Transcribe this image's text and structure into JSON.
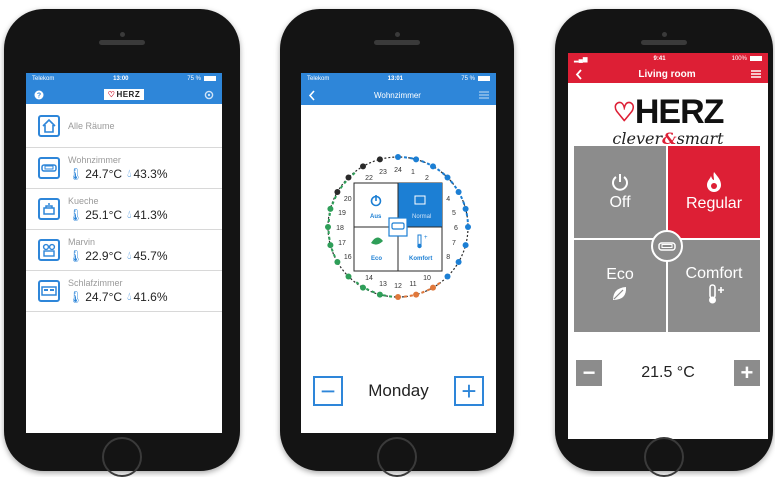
{
  "phone_list": {
    "status": {
      "carrier": "Telekom",
      "time": "13:00",
      "battery": "75 %"
    },
    "header": {
      "help_icon": "help-icon",
      "logo": "HERZ",
      "settings_icon": "gear-icon"
    },
    "rooms": [
      {
        "name": "Alle Räume",
        "temp": "",
        "humidity": "",
        "icon": "house-icon"
      },
      {
        "name": "Wohnzimmer",
        "temp": "24.7°C",
        "humidity": "43.3%",
        "icon": "sofa-icon"
      },
      {
        "name": "Kueche",
        "temp": "25.1°C",
        "humidity": "41.3%",
        "icon": "pot-icon"
      },
      {
        "name": "Marvin",
        "temp": "22.9°C",
        "humidity": "45.7%",
        "icon": "toys-icon"
      },
      {
        "name": "Schlafzimmer",
        "temp": "24.7°C",
        "humidity": "41.6%",
        "icon": "bed-icon"
      }
    ]
  },
  "phone_schedule": {
    "status": {
      "carrier": "Telekom",
      "time": "13:01",
      "battery": "75 %"
    },
    "header": {
      "title": "Wohnzimmer"
    },
    "modes": [
      "Aus",
      "Normal",
      "Eco",
      "Komfort"
    ],
    "clock_hours": [
      "24",
      "1",
      "2",
      "3",
      "4",
      "5",
      "6",
      "7",
      "8",
      "9",
      "10",
      "11",
      "12",
      "13",
      "14",
      "15",
      "16",
      "17",
      "18",
      "19",
      "20",
      "21",
      "22",
      "23"
    ],
    "day": "Monday",
    "minus": "−",
    "plus": "+"
  },
  "phone_room": {
    "status": {
      "time": "9:41",
      "battery": "100%"
    },
    "header": {
      "title": "Living room"
    },
    "logo": {
      "brand": "HERZ",
      "tagline_1": "clever",
      "tagline_amp": "&",
      "tagline_2": "smart"
    },
    "modes": [
      {
        "label": "Off",
        "icon": "power-icon",
        "active": false
      },
      {
        "label": "Regular",
        "icon": "flame-icon",
        "active": true
      },
      {
        "label": "Eco",
        "icon": "leaf-icon",
        "active": false
      },
      {
        "label": "Comfort",
        "icon": "thermometer-plus-icon",
        "active": false
      }
    ],
    "temperature": "21.5 °C",
    "minus": "−",
    "plus": "+",
    "colors": {
      "accent": "#dd1f35",
      "tile": "#8c8c8c"
    }
  }
}
